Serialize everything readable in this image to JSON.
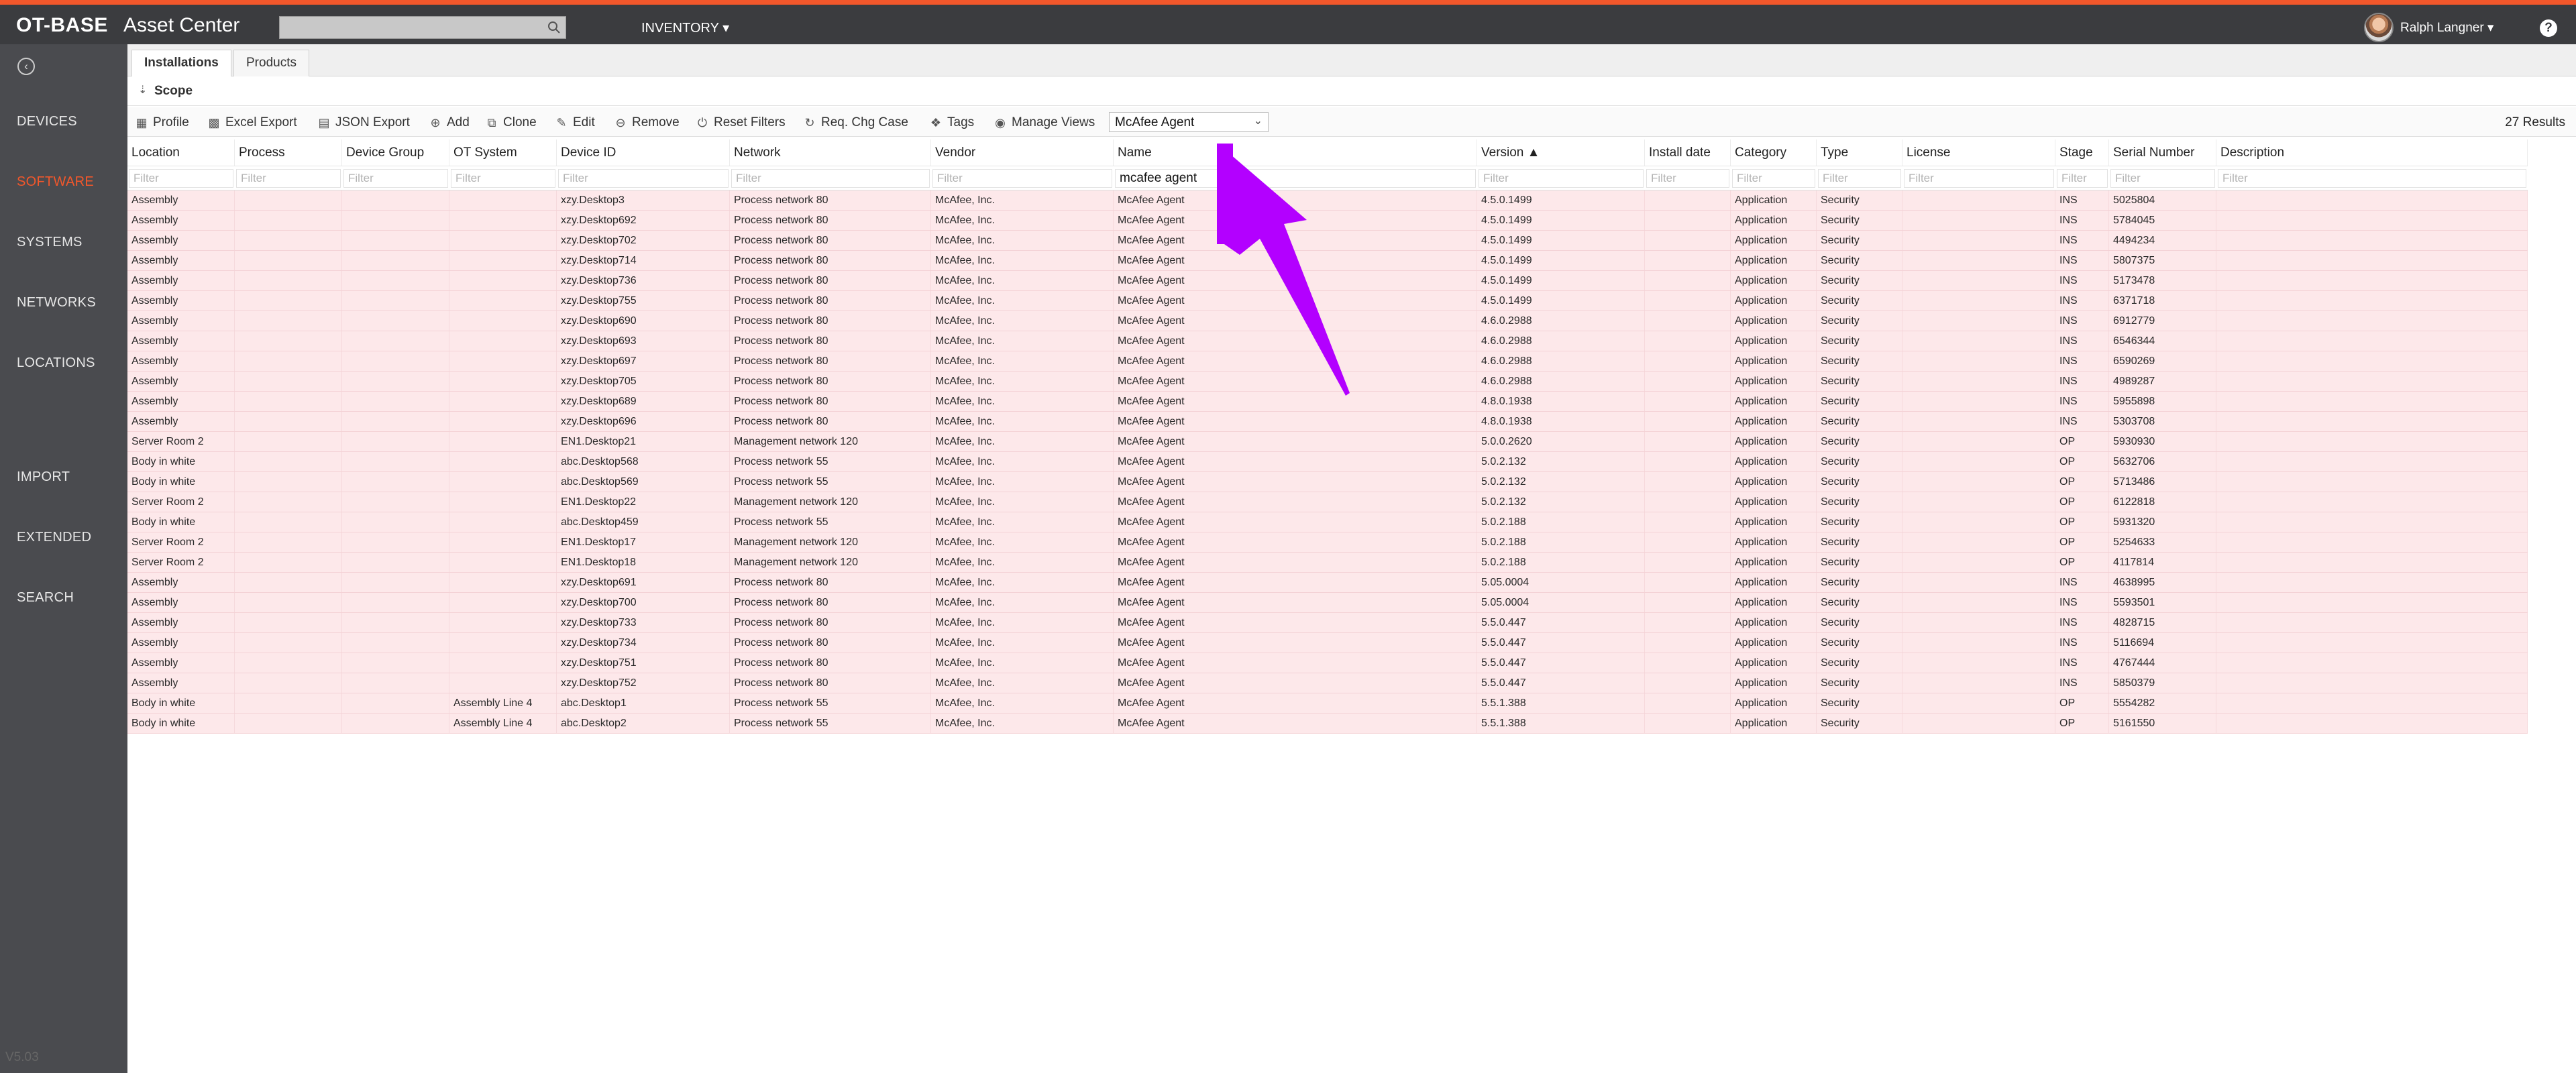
{
  "brand": {
    "ot": "OT-BASE",
    "app": "Asset Center"
  },
  "topbar": {
    "inventory_label": "INVENTORY ▾",
    "user_name": "Ralph Langner ▾",
    "help_label": "?"
  },
  "sidebar": {
    "items": [
      {
        "label": "DEVICES",
        "active": false
      },
      {
        "label": "SOFTWARE",
        "active": true
      },
      {
        "label": "SYSTEMS",
        "active": false
      },
      {
        "label": "NETWORKS",
        "active": false
      },
      {
        "label": "LOCATIONS",
        "active": false
      },
      {
        "label": "IMPORT",
        "active": false
      },
      {
        "label": "EXTENDED",
        "active": false
      },
      {
        "label": "SEARCH",
        "active": false
      }
    ],
    "version": "V5.03"
  },
  "tabs": [
    {
      "label": "Installations",
      "active": true
    },
    {
      "label": "Products",
      "active": false
    }
  ],
  "scope": {
    "label": "Scope"
  },
  "toolbar": {
    "buttons": [
      "Profile",
      "Excel Export",
      "JSON Export",
      "Add",
      "Clone",
      "Edit",
      "Remove",
      "Reset Filters",
      "Req. Chg Case",
      "Tags",
      "Manage Views"
    ],
    "selected_view": "McAfee Agent",
    "results": "27 Results"
  },
  "table": {
    "columns": [
      "Location",
      "Process",
      "Device Group",
      "OT System",
      "Device ID",
      "Network",
      "Vendor",
      "Name",
      "Version ▲",
      "Install date",
      "Category",
      "Type",
      "License",
      "Stage",
      "Serial Number",
      "Description"
    ],
    "filter_placeholder": "Filter",
    "name_filter_value": "mcafee agent",
    "rows": [
      [
        "Assembly",
        "",
        "",
        "",
        "xzy.Desktop3",
        "Process network 80",
        "McAfee, Inc.",
        "McAfee Agent",
        "4.5.0.1499",
        "",
        "Application",
        "Security",
        "",
        "INS",
        "5025804",
        ""
      ],
      [
        "Assembly",
        "",
        "",
        "",
        "xzy.Desktop692",
        "Process network 80",
        "McAfee, Inc.",
        "McAfee Agent",
        "4.5.0.1499",
        "",
        "Application",
        "Security",
        "",
        "INS",
        "5784045",
        ""
      ],
      [
        "Assembly",
        "",
        "",
        "",
        "xzy.Desktop702",
        "Process network 80",
        "McAfee, Inc.",
        "McAfee Agent",
        "4.5.0.1499",
        "",
        "Application",
        "Security",
        "",
        "INS",
        "4494234",
        ""
      ],
      [
        "Assembly",
        "",
        "",
        "",
        "xzy.Desktop714",
        "Process network 80",
        "McAfee, Inc.",
        "McAfee Agent",
        "4.5.0.1499",
        "",
        "Application",
        "Security",
        "",
        "INS",
        "5807375",
        ""
      ],
      [
        "Assembly",
        "",
        "",
        "",
        "xzy.Desktop736",
        "Process network 80",
        "McAfee, Inc.",
        "McAfee Agent",
        "4.5.0.1499",
        "",
        "Application",
        "Security",
        "",
        "INS",
        "5173478",
        ""
      ],
      [
        "Assembly",
        "",
        "",
        "",
        "xzy.Desktop755",
        "Process network 80",
        "McAfee, Inc.",
        "McAfee Agent",
        "4.5.0.1499",
        "",
        "Application",
        "Security",
        "",
        "INS",
        "6371718",
        ""
      ],
      [
        "Assembly",
        "",
        "",
        "",
        "xzy.Desktop690",
        "Process network 80",
        "McAfee, Inc.",
        "McAfee Agent",
        "4.6.0.2988",
        "",
        "Application",
        "Security",
        "",
        "INS",
        "6912779",
        ""
      ],
      [
        "Assembly",
        "",
        "",
        "",
        "xzy.Desktop693",
        "Process network 80",
        "McAfee, Inc.",
        "McAfee Agent",
        "4.6.0.2988",
        "",
        "Application",
        "Security",
        "",
        "INS",
        "6546344",
        ""
      ],
      [
        "Assembly",
        "",
        "",
        "",
        "xzy.Desktop697",
        "Process network 80",
        "McAfee, Inc.",
        "McAfee Agent",
        "4.6.0.2988",
        "",
        "Application",
        "Security",
        "",
        "INS",
        "6590269",
        ""
      ],
      [
        "Assembly",
        "",
        "",
        "",
        "xzy.Desktop705",
        "Process network 80",
        "McAfee, Inc.",
        "McAfee Agent",
        "4.6.0.2988",
        "",
        "Application",
        "Security",
        "",
        "INS",
        "4989287",
        ""
      ],
      [
        "Assembly",
        "",
        "",
        "",
        "xzy.Desktop689",
        "Process network 80",
        "McAfee, Inc.",
        "McAfee Agent",
        "4.8.0.1938",
        "",
        "Application",
        "Security",
        "",
        "INS",
        "5955898",
        ""
      ],
      [
        "Assembly",
        "",
        "",
        "",
        "xzy.Desktop696",
        "Process network 80",
        "McAfee, Inc.",
        "McAfee Agent",
        "4.8.0.1938",
        "",
        "Application",
        "Security",
        "",
        "INS",
        "5303708",
        ""
      ],
      [
        "Server Room 2",
        "",
        "",
        "",
        "EN1.Desktop21",
        "Management network 120",
        "McAfee, Inc.",
        "McAfee Agent",
        "5.0.0.2620",
        "",
        "Application",
        "Security",
        "",
        "OP",
        "5930930",
        ""
      ],
      [
        "Body in white",
        "",
        "",
        "",
        "abc.Desktop568",
        "Process network 55",
        "McAfee, Inc.",
        "McAfee Agent",
        "5.0.2.132",
        "",
        "Application",
        "Security",
        "",
        "OP",
        "5632706",
        ""
      ],
      [
        "Body in white",
        "",
        "",
        "",
        "abc.Desktop569",
        "Process network 55",
        "McAfee, Inc.",
        "McAfee Agent",
        "5.0.2.132",
        "",
        "Application",
        "Security",
        "",
        "OP",
        "5713486",
        ""
      ],
      [
        "Server Room 2",
        "",
        "",
        "",
        "EN1.Desktop22",
        "Management network 120",
        "McAfee, Inc.",
        "McAfee Agent",
        "5.0.2.132",
        "",
        "Application",
        "Security",
        "",
        "OP",
        "6122818",
        ""
      ],
      [
        "Body in white",
        "",
        "",
        "",
        "abc.Desktop459",
        "Process network 55",
        "McAfee, Inc.",
        "McAfee Agent",
        "5.0.2.188",
        "",
        "Application",
        "Security",
        "",
        "OP",
        "5931320",
        ""
      ],
      [
        "Server Room 2",
        "",
        "",
        "",
        "EN1.Desktop17",
        "Management network 120",
        "McAfee, Inc.",
        "McAfee Agent",
        "5.0.2.188",
        "",
        "Application",
        "Security",
        "",
        "OP",
        "5254633",
        ""
      ],
      [
        "Server Room 2",
        "",
        "",
        "",
        "EN1.Desktop18",
        "Management network 120",
        "McAfee, Inc.",
        "McAfee Agent",
        "5.0.2.188",
        "",
        "Application",
        "Security",
        "",
        "OP",
        "4117814",
        ""
      ],
      [
        "Assembly",
        "",
        "",
        "",
        "xzy.Desktop691",
        "Process network 80",
        "McAfee, Inc.",
        "McAfee Agent",
        "5.05.0004",
        "",
        "Application",
        "Security",
        "",
        "INS",
        "4638995",
        ""
      ],
      [
        "Assembly",
        "",
        "",
        "",
        "xzy.Desktop700",
        "Process network 80",
        "McAfee, Inc.",
        "McAfee Agent",
        "5.05.0004",
        "",
        "Application",
        "Security",
        "",
        "INS",
        "5593501",
        ""
      ],
      [
        "Assembly",
        "",
        "",
        "",
        "xzy.Desktop733",
        "Process network 80",
        "McAfee, Inc.",
        "McAfee Agent",
        "5.5.0.447",
        "",
        "Application",
        "Security",
        "",
        "INS",
        "4828715",
        ""
      ],
      [
        "Assembly",
        "",
        "",
        "",
        "xzy.Desktop734",
        "Process network 80",
        "McAfee, Inc.",
        "McAfee Agent",
        "5.5.0.447",
        "",
        "Application",
        "Security",
        "",
        "INS",
        "5116694",
        ""
      ],
      [
        "Assembly",
        "",
        "",
        "",
        "xzy.Desktop751",
        "Process network 80",
        "McAfee, Inc.",
        "McAfee Agent",
        "5.5.0.447",
        "",
        "Application",
        "Security",
        "",
        "INS",
        "4767444",
        ""
      ],
      [
        "Assembly",
        "",
        "",
        "",
        "xzy.Desktop752",
        "Process network 80",
        "McAfee, Inc.",
        "McAfee Agent",
        "5.5.0.447",
        "",
        "Application",
        "Security",
        "",
        "INS",
        "5850379",
        ""
      ],
      [
        "Body in white",
        "",
        "",
        "Assembly Line 4",
        "abc.Desktop1",
        "Process network 55",
        "McAfee, Inc.",
        "McAfee Agent",
        "5.5.1.388",
        "",
        "Application",
        "Security",
        "",
        "OP",
        "5554282",
        ""
      ],
      [
        "Body in white",
        "",
        "",
        "Assembly Line 4",
        "abc.Desktop2",
        "Process network 55",
        "McAfee, Inc.",
        "McAfee Agent",
        "5.5.1.388",
        "",
        "Application",
        "Security",
        "",
        "OP",
        "5161550",
        ""
      ]
    ]
  },
  "colors": {
    "accent": "#f2572b",
    "topbar": "#3b3c3f",
    "sidebar": "#4a4b4f",
    "row_highlight": "#fde8ea",
    "annotation_arrow": "#b300ff"
  },
  "icons": [
    "search-icon",
    "back-icon",
    "help-icon",
    "profile-icon",
    "excel-icon",
    "json-icon",
    "add-icon",
    "clone-icon",
    "edit-icon",
    "remove-icon",
    "reset-icon",
    "req-change-icon",
    "tag-icon",
    "eye-icon",
    "chevron-down-icon"
  ]
}
